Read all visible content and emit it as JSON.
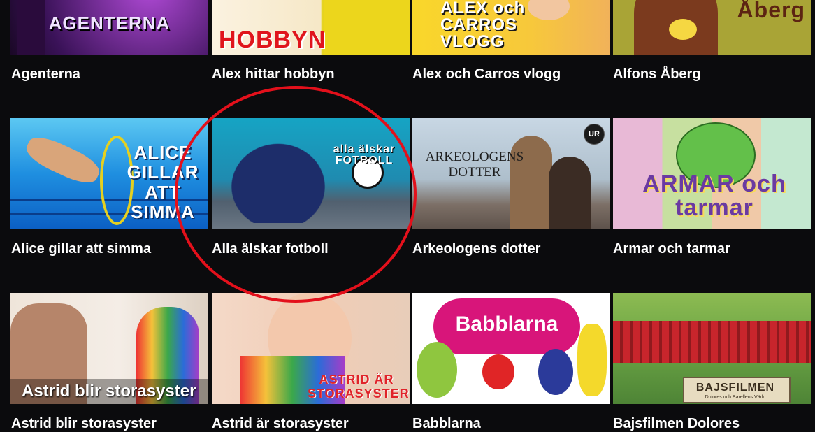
{
  "row1": [
    {
      "label": "Agenterna",
      "art": "AGENTERNA"
    },
    {
      "label": "Alex hittar hobbyn",
      "art": "HOBBYN"
    },
    {
      "label": "Alex och Carros vlogg",
      "art": "ALEX och CARROS VLOGG"
    },
    {
      "label": "Alfons Åberg",
      "art": "Åberg"
    }
  ],
  "row2": [
    {
      "label": "Alice gillar att simma",
      "art": "ALICE GILLAR ATT SIMMA"
    },
    {
      "label": "Alla älskar fotboll",
      "art": "alla älskar FOTBOLL"
    },
    {
      "label": "Arkeologens dotter",
      "art": "ARKEOLOGENS DOTTER",
      "badge": "UR"
    },
    {
      "label": "Armar och tarmar",
      "art": "ARMAR och tarmar"
    }
  ],
  "row3": [
    {
      "label": "Astrid blir storasyster",
      "art": "Astrid blir storasyster"
    },
    {
      "label": "Astrid är storasyster",
      "art": "ASTRID ÄR STORASYSTER"
    },
    {
      "label": "Babblarna",
      "art": "Babblarna"
    },
    {
      "label": "Bajsfilmen Dolores",
      "art": "BAJSFILMEN",
      "art_sub": "Dolores och Barellens Värld"
    }
  ],
  "colors": {
    "background": "#0b0b0d",
    "annotation": "#e3101b"
  }
}
